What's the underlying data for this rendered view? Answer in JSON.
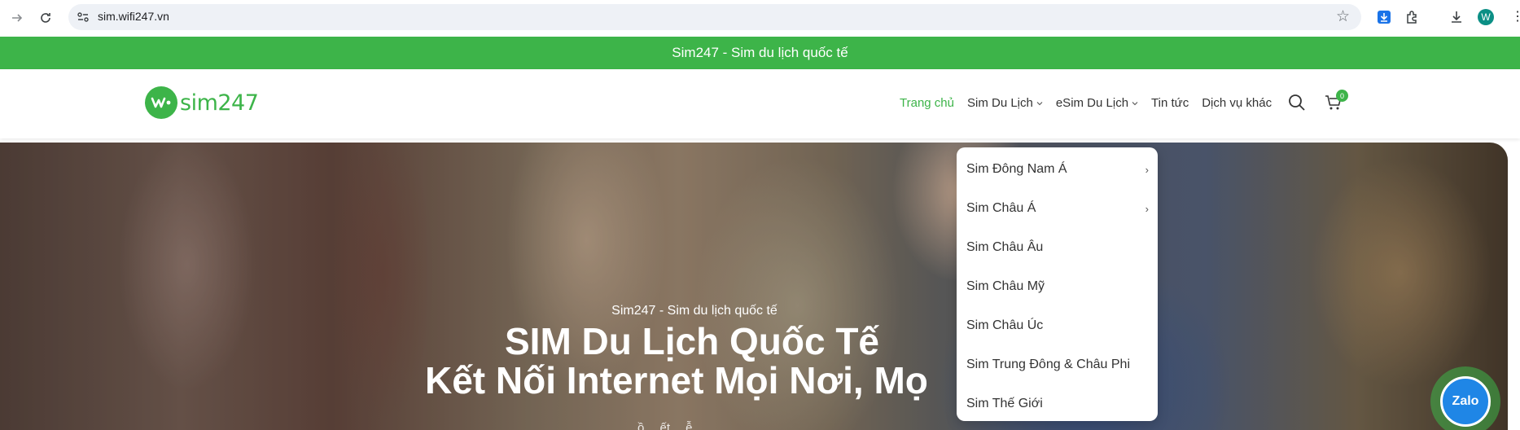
{
  "browser": {
    "url": "sim.wifi247.vn",
    "profile_initial": "W"
  },
  "announcement": "Sim247 - Sim du lịch quốc tế",
  "header": {
    "logo_text": "sim247",
    "menu": [
      {
        "label": "Trang chủ",
        "active": true
      },
      {
        "label": "Sim Du Lịch",
        "has_caret": true
      },
      {
        "label": "eSim Du Lịch",
        "has_caret": true
      },
      {
        "label": "Tin tức"
      },
      {
        "label": "Dịch vụ khác"
      }
    ],
    "cart_count": "0"
  },
  "hero": {
    "subtitle": "Sim247 - Sim du lịch quốc tế",
    "title_line1": "SIM Du Lịch Quốc Tế",
    "title_line2": "Kết Nối Internet Mọi Nơi, Mọ",
    "partial_text": "…ồ …ết …ễ…"
  },
  "dropdown": {
    "items": [
      {
        "label": "Sim Đông Nam Á",
        "has_submenu": true
      },
      {
        "label": "Sim Châu Á",
        "has_submenu": true
      },
      {
        "label": "Sim Châu Âu"
      },
      {
        "label": "Sim Châu Mỹ"
      },
      {
        "label": "Sim Châu Úc"
      },
      {
        "label": "Sim Trung Đông & Châu Phi"
      },
      {
        "label": "Sim Thế Giới"
      }
    ]
  },
  "zalo": {
    "label": "Zalo"
  },
  "colors": {
    "brand": "#3db449",
    "zalo": "#1f86e6"
  }
}
